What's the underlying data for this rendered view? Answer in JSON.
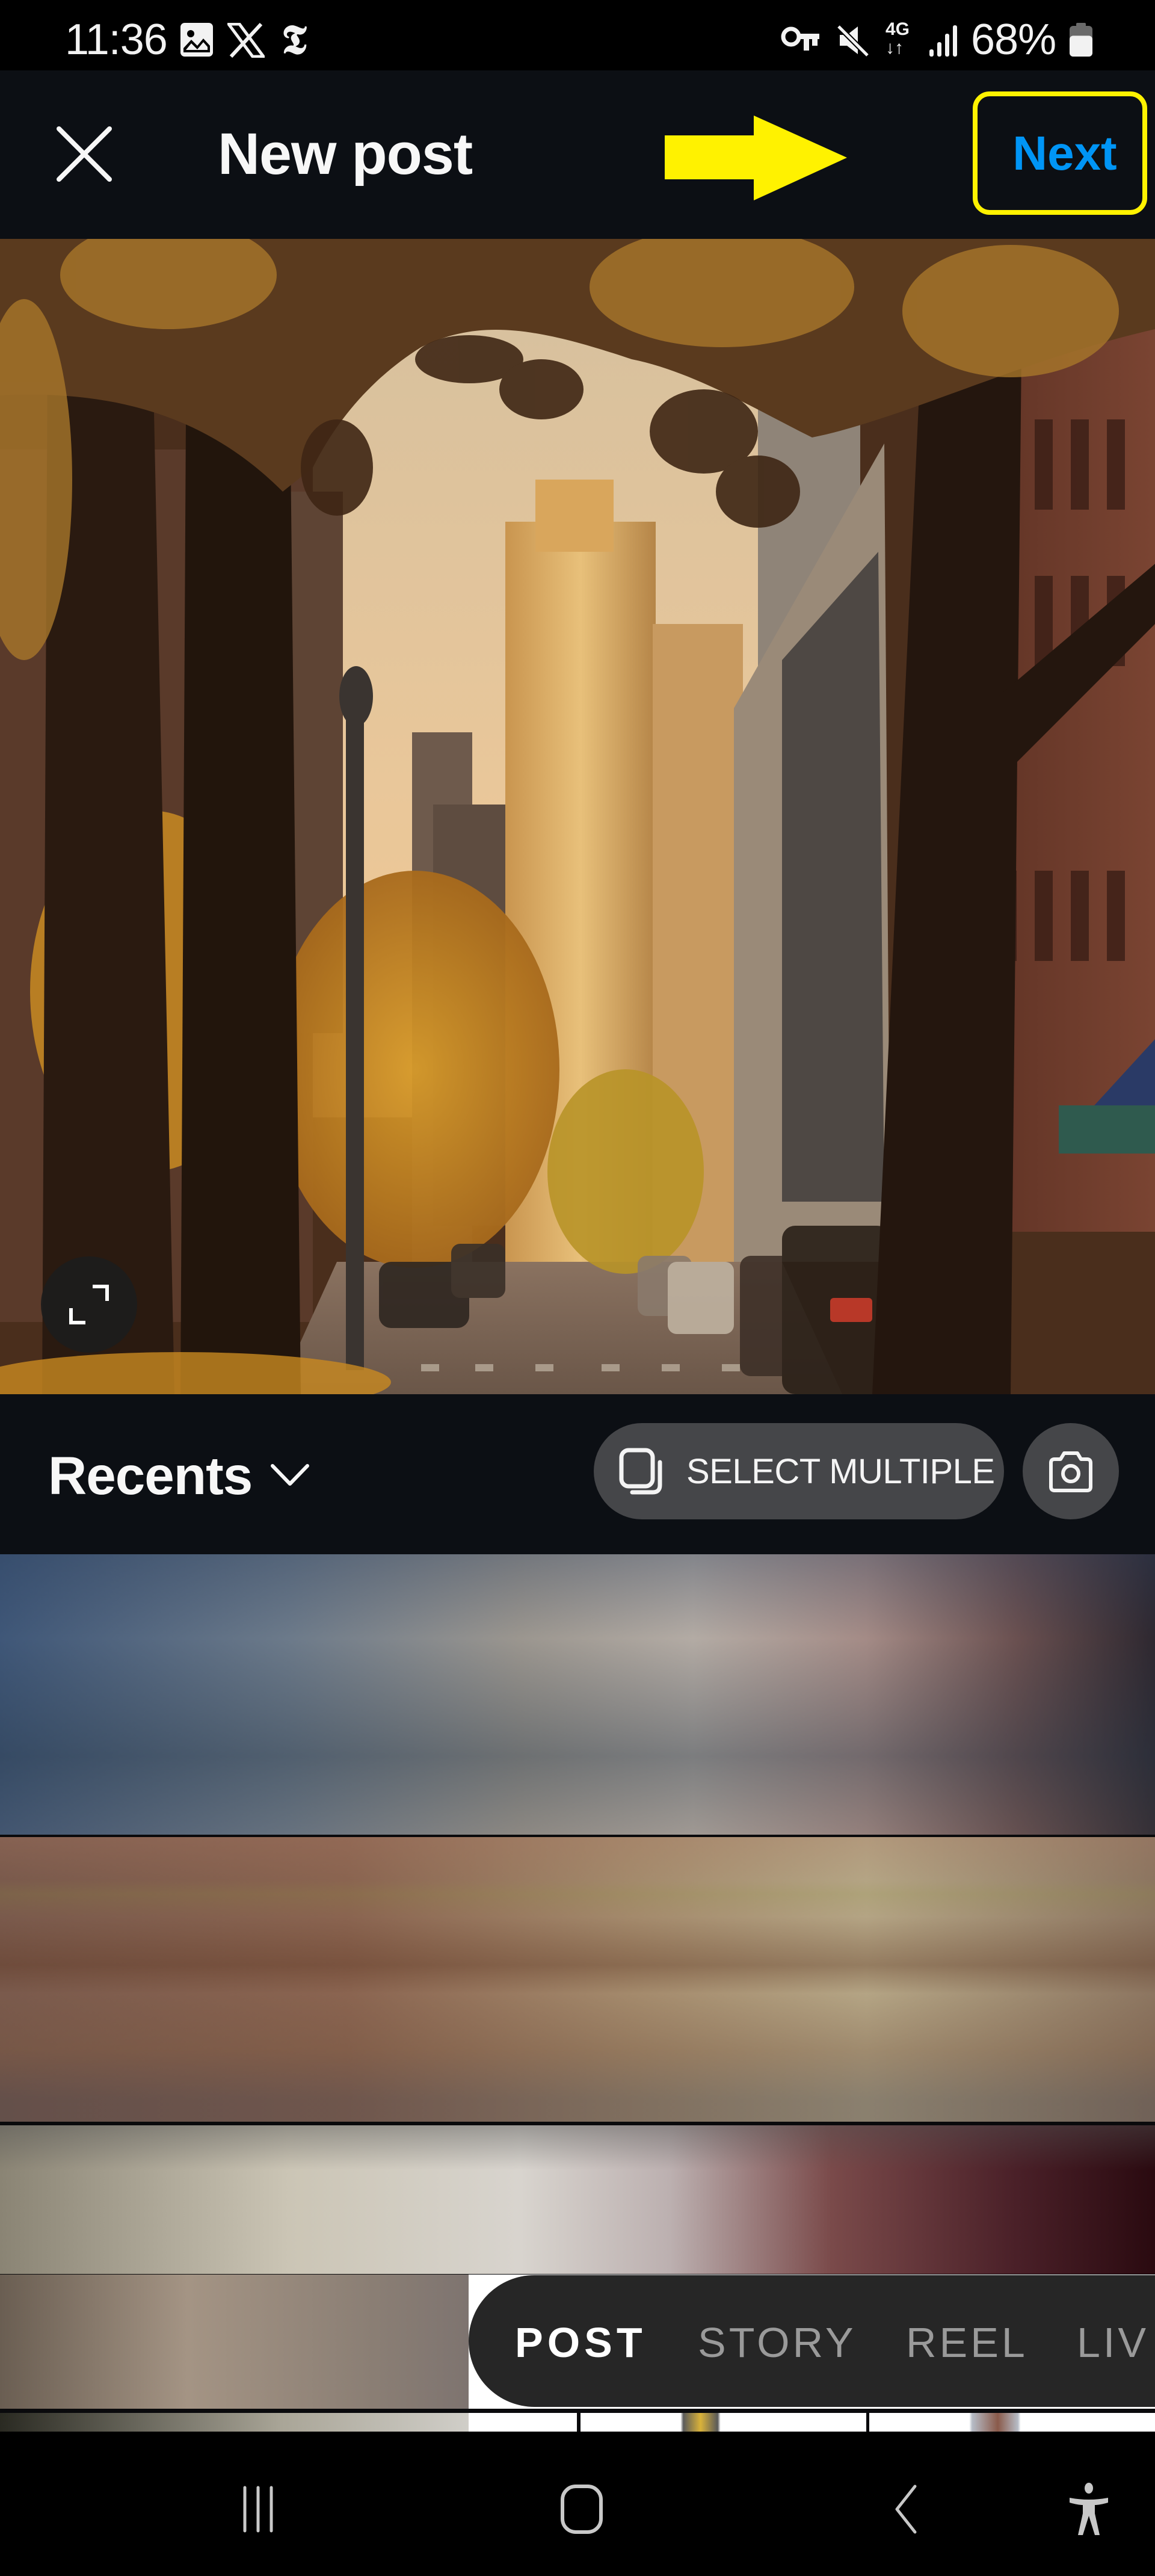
{
  "status_bar": {
    "time": "11:36",
    "notification_icons": [
      "gallery-icon",
      "x-logo-icon",
      "nyt-logo-icon"
    ],
    "system_icons": [
      "vpn-key-icon",
      "mute-icon",
      "4g-data-icon",
      "signal-icon"
    ],
    "network_label": "4G",
    "battery_percent": "68%",
    "battery_level": 0.68
  },
  "header": {
    "title": "New post",
    "close_icon": "close-icon",
    "next_label": "Next",
    "annotation": {
      "type": "arrow-pointing-right",
      "highlight_target": "next-button"
    }
  },
  "preview": {
    "description": "Autumn city street framed by trees with golden high-rise building",
    "expand_icon": "expand-icon"
  },
  "gallery_bar": {
    "album_label": "Recents",
    "select_multiple_label": "SELECT MULTIPLE",
    "camera_icon": "camera-icon"
  },
  "gallery": {
    "thumbnails": [
      {
        "row": 1,
        "label": "blurred thumbnail 1"
      },
      {
        "row": 2,
        "label": "blurred thumbnail 2"
      },
      {
        "row": 3,
        "label": "blurred thumbnail 3"
      },
      {
        "row": 4,
        "label": "partially loaded thumbnails"
      }
    ]
  },
  "mode_selector": {
    "tabs": [
      {
        "label": "POST",
        "active": true
      },
      {
        "label": "STORY",
        "active": false
      },
      {
        "label": "REEL",
        "active": false
      },
      {
        "label": "LIV",
        "active": false
      }
    ]
  },
  "nav_bar": {
    "buttons": [
      "recent-apps-icon",
      "home-icon",
      "back-icon",
      "accessibility-icon"
    ]
  },
  "colors": {
    "accent": "#0095f6",
    "annotation": "#fff200",
    "header_bg": "#0c0f14",
    "pill_bg": "#454649",
    "mode_bg": "#262626"
  }
}
